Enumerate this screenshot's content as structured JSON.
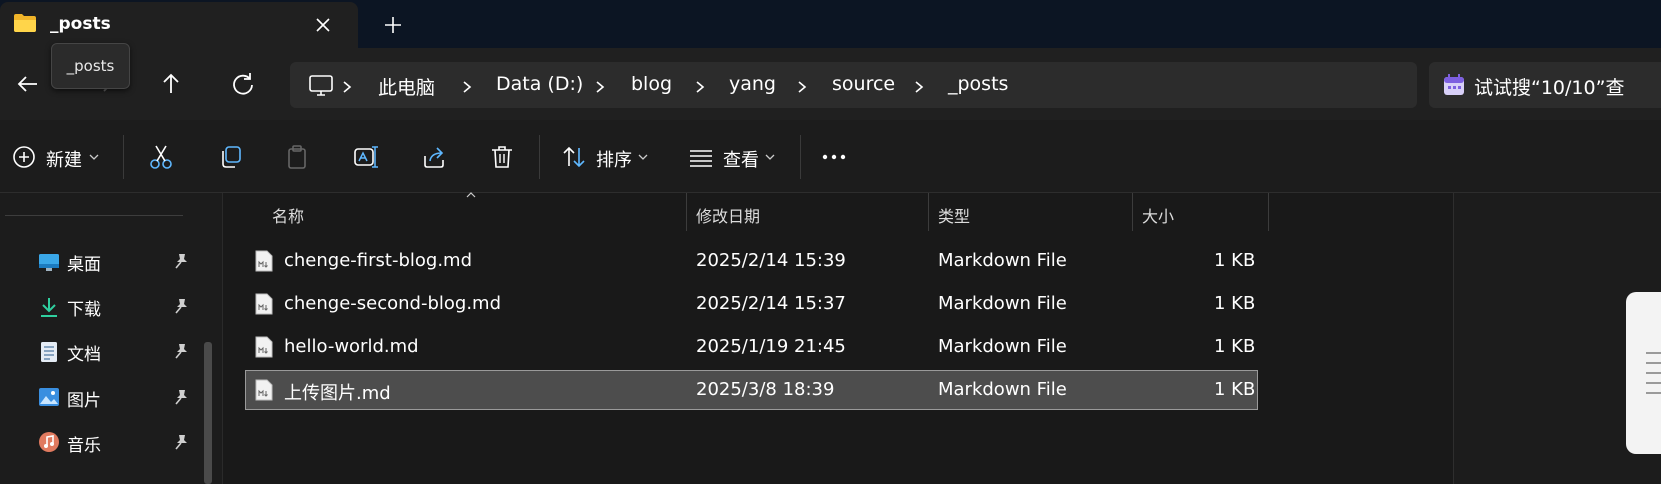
{
  "tab": {
    "title": "_posts",
    "tooltip": "_posts"
  },
  "breadcrumb": [
    "此电脑",
    "Data (D:)",
    "blog",
    "yang",
    "source",
    "_posts"
  ],
  "search": {
    "text": "试试搜“10/10”查"
  },
  "toolbar": {
    "new_label": "新建",
    "sort_label": "排序",
    "view_label": "查看"
  },
  "quick_access": [
    {
      "label": "桌面",
      "icon": "desktop-icon"
    },
    {
      "label": "下载",
      "icon": "download-icon"
    },
    {
      "label": "文档",
      "icon": "document-icon"
    },
    {
      "label": "图片",
      "icon": "picture-icon"
    },
    {
      "label": "音乐",
      "icon": "music-icon"
    }
  ],
  "columns": {
    "name": "名称",
    "modified": "修改日期",
    "type": "类型",
    "size": "大小"
  },
  "files": [
    {
      "name": "chenge-first-blog.md",
      "modified": "2025/2/14 15:39",
      "type": "Markdown File",
      "size": "1 KB"
    },
    {
      "name": "chenge-second-blog.md",
      "modified": "2025/2/14 15:37",
      "type": "Markdown File",
      "size": "1 KB"
    },
    {
      "name": "hello-world.md",
      "modified": "2025/1/19 21:45",
      "type": "Markdown File",
      "size": "1 KB"
    },
    {
      "name": "上传图片.md",
      "modified": "2025/3/8 18:39",
      "type": "Markdown File",
      "size": "1 KB",
      "selected": true
    }
  ],
  "colors": {
    "background": "#191919",
    "titlebar": "#0c1523",
    "selection": "#4d4d4d",
    "accent_blue": "#60b0ff"
  }
}
